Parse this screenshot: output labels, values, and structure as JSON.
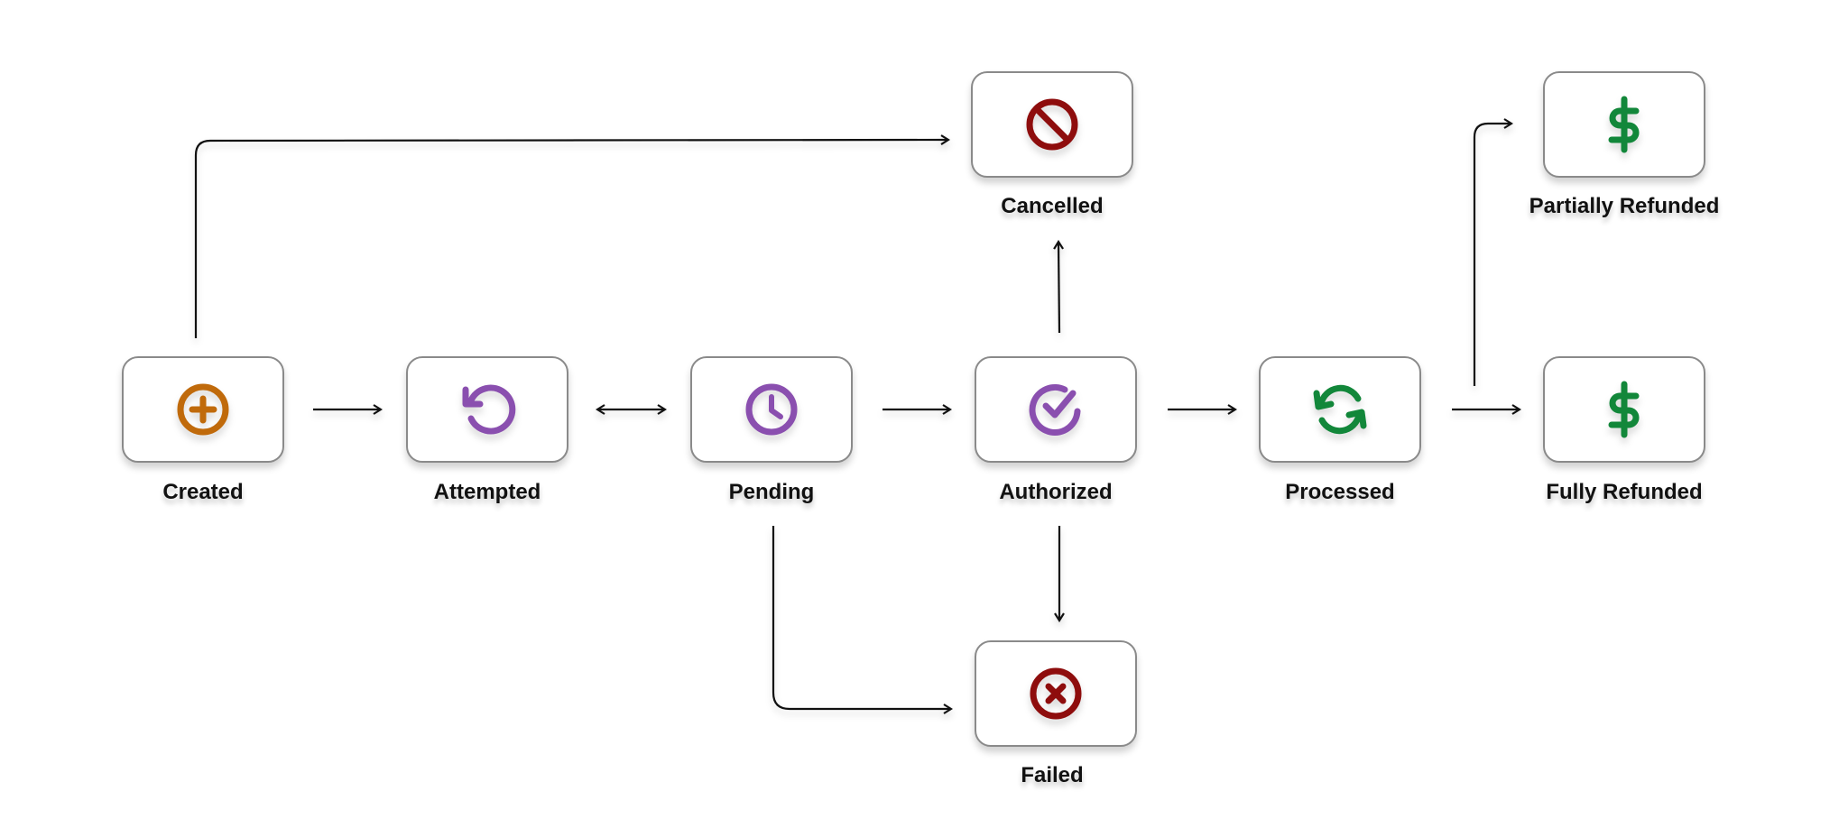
{
  "diagram": {
    "type": "state-flow",
    "nodes": [
      {
        "id": "created",
        "label": "Created",
        "icon": "plus-circle-icon",
        "color": "#C06A0B"
      },
      {
        "id": "attempted",
        "label": "Attempted",
        "icon": "retry-icon",
        "color": "#8A4FAF"
      },
      {
        "id": "pending",
        "label": "Pending",
        "icon": "clock-icon",
        "color": "#8A4FAF"
      },
      {
        "id": "authorized",
        "label": "Authorized",
        "icon": "check-circle-icon",
        "color": "#8A4FAF"
      },
      {
        "id": "processed",
        "label": "Processed",
        "icon": "sync-icon",
        "color": "#12873A"
      },
      {
        "id": "fully_refunded",
        "label": "Fully Refunded",
        "icon": "dollar-icon",
        "color": "#12873A"
      },
      {
        "id": "cancelled",
        "label": "Cancelled",
        "icon": "ban-icon",
        "color": "#8E0D0D"
      },
      {
        "id": "partially_refunded",
        "label": "Partially Refunded",
        "icon": "dollar-icon",
        "color": "#12873A"
      },
      {
        "id": "failed",
        "label": "Failed",
        "icon": "x-circle-icon",
        "color": "#8E0D0D"
      }
    ],
    "edges": [
      {
        "from": "created",
        "to": "attempted",
        "bidirectional": false
      },
      {
        "from": "attempted",
        "to": "pending",
        "bidirectional": true
      },
      {
        "from": "pending",
        "to": "authorized",
        "bidirectional": false
      },
      {
        "from": "authorized",
        "to": "processed",
        "bidirectional": false
      },
      {
        "from": "processed",
        "to": "fully_refunded",
        "bidirectional": false
      },
      {
        "from": "processed",
        "to": "partially_refunded",
        "bidirectional": false
      },
      {
        "from": "created",
        "to": "cancelled",
        "bidirectional": false
      },
      {
        "from": "authorized",
        "to": "cancelled",
        "bidirectional": false
      },
      {
        "from": "authorized",
        "to": "failed",
        "bidirectional": false
      },
      {
        "from": "pending",
        "to": "failed",
        "bidirectional": false
      }
    ]
  }
}
